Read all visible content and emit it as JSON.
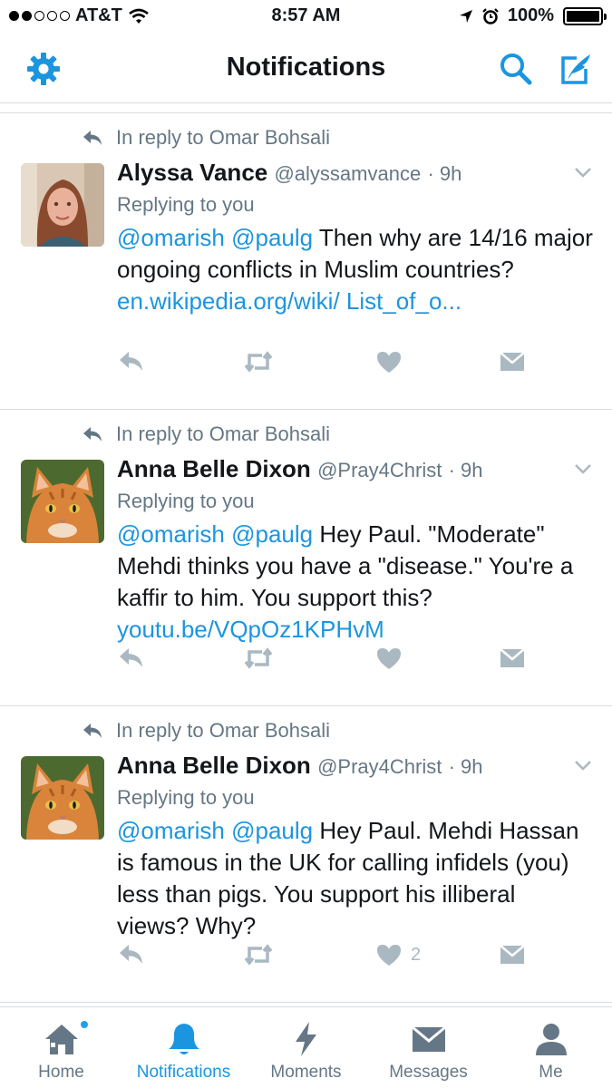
{
  "status_bar": {
    "carrier": "AT&T",
    "time": "8:57 AM",
    "battery": "100%",
    "signal_bars_filled": 2,
    "signal_bars_total": 5,
    "battery_level": 1.0
  },
  "nav": {
    "title": "Notifications",
    "left_icon": "gear-icon",
    "right_icons": [
      "search-icon",
      "compose-icon"
    ],
    "accent_color": "#1b95e0"
  },
  "tweets": [
    {
      "reply_context": "In reply to Omar Bohsali",
      "name": "Alyssa Vance",
      "handle": "@alyssamvance",
      "time": "· 9h",
      "replying": "Replying to you",
      "mentions": "@omarish @paulg",
      "text": " Then why are 14/16 major ongoing conflicts in Muslim countries? ",
      "link": "en.wikipedia.org/wiki/ List_of_o...",
      "like_count": ""
    },
    {
      "reply_context": "In reply to Omar Bohsali",
      "name": "Anna Belle Dixon",
      "handle": "@Pray4Christ",
      "time": "· 9h",
      "replying": "Replying to you",
      "mentions": "@omarish @paulg",
      "text": " Hey Paul. \"Moderate\" Mehdi thinks you have a \"disease.\" You're a kaffir to him. You support this? ",
      "link": "youtu.be/VQpOz1KPHvM",
      "like_count": ""
    },
    {
      "reply_context": "In reply to Omar Bohsali",
      "name": "Anna Belle Dixon",
      "handle": "@Pray4Christ",
      "time": "· 9h",
      "replying": "Replying to you",
      "mentions": "@omarish @paulg",
      "text": " Hey Paul. Mehdi Hassan is famous in the UK for calling infidels (you) less than pigs. You support his illiberal views? Why?",
      "link": "",
      "like_count": "2"
    }
  ],
  "tab_bar": {
    "tabs": [
      {
        "label": "Home",
        "icon": "home-icon"
      },
      {
        "label": "Notifications",
        "icon": "bell-icon"
      },
      {
        "label": "Moments",
        "icon": "lightning-icon"
      },
      {
        "label": "Messages",
        "icon": "envelope-icon"
      },
      {
        "label": "Me",
        "icon": "person-icon"
      }
    ],
    "active": "Notifications"
  }
}
